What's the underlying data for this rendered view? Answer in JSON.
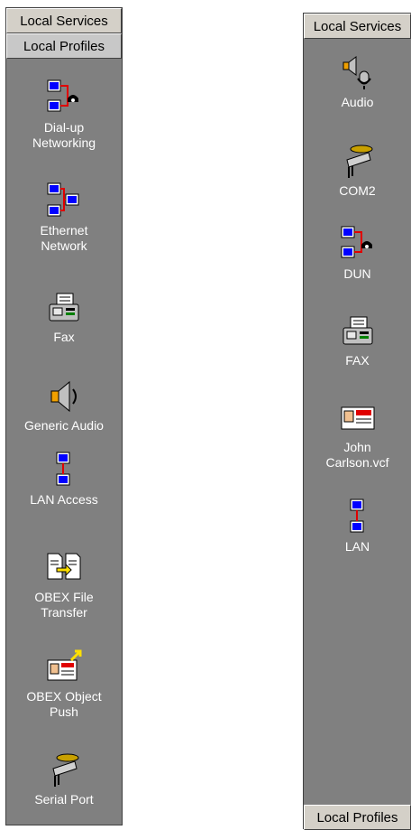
{
  "left_panel": {
    "top_tab": "Local Services",
    "active_tab": "Local Profiles",
    "items": [
      {
        "label": "Dial-up\nNetworking",
        "icon": "dialup-networking-icon"
      },
      {
        "label": "Ethernet\nNetwork",
        "icon": "ethernet-network-icon"
      },
      {
        "label": "Fax",
        "icon": "fax-icon"
      },
      {
        "label": "Generic Audio",
        "icon": "speaker-icon"
      },
      {
        "label": "LAN Access",
        "icon": "lan-access-icon"
      },
      {
        "label": "OBEX File\nTransfer",
        "icon": "file-transfer-icon"
      },
      {
        "label": "OBEX Object\nPush",
        "icon": "business-card-push-icon"
      },
      {
        "label": "Serial Port",
        "icon": "serial-port-icon"
      }
    ]
  },
  "right_panel": {
    "top_tab": "Local Services",
    "bottom_tab": "Local Profiles",
    "items": [
      {
        "label": "Audio",
        "icon": "headset-audio-icon"
      },
      {
        "label": "COM2",
        "icon": "serial-port-icon"
      },
      {
        "label": "DUN",
        "icon": "dialup-networking-icon"
      },
      {
        "label": "FAX",
        "icon": "fax-icon"
      },
      {
        "label": "John\nCarlson.vcf",
        "icon": "business-card-icon"
      },
      {
        "label": "LAN",
        "icon": "lan-access-icon"
      }
    ]
  },
  "colors": {
    "panel_bg": "#808080",
    "tab_bg": "#d4d0c8",
    "label_text": "#ffffff",
    "link_red": "#e00000",
    "monitor_blue": "#0000ff"
  }
}
